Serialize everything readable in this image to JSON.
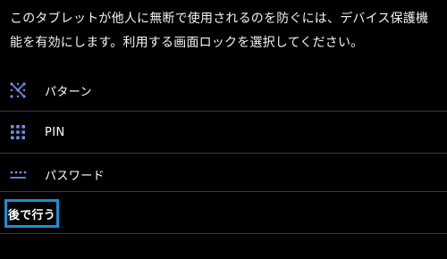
{
  "description": "このタブレットが他人に無断で使用されるのを防ぐには、デバイス保護機能を有効にします。利用する画面ロックを選択してください。",
  "options": [
    {
      "label": "パターン",
      "icon": "pattern-icon"
    },
    {
      "label": "PIN",
      "icon": "pin-icon"
    },
    {
      "label": "パスワード",
      "icon": "password-icon"
    }
  ],
  "later_button": {
    "label": "後で行う"
  },
  "colors": {
    "background": "#000000",
    "text": "#ffffff",
    "icon_accent": "#6f8fe8",
    "focus_border": "#1b8fd6",
    "divider": "#3a3a3a"
  }
}
